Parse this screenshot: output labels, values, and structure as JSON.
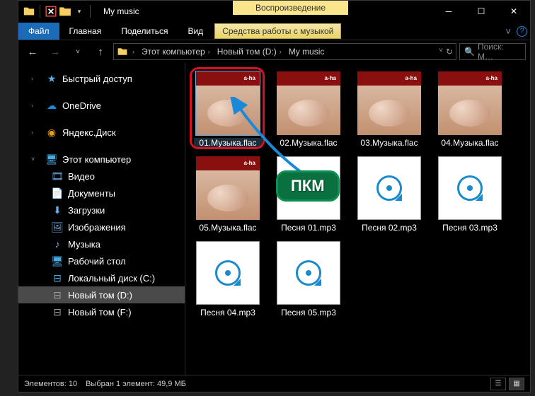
{
  "title": "My music",
  "context_tab": "Воспроизведение",
  "ribbon": {
    "file": "Файл",
    "home": "Главная",
    "share": "Поделиться",
    "view": "Вид",
    "music_tools": "Средства работы с музыкой"
  },
  "breadcrumb": {
    "this_pc": "Этот компьютер",
    "drive": "Новый том (D:)",
    "folder": "My music"
  },
  "search_placeholder": "Поиск: M…",
  "sidebar": {
    "quick_access": "Быстрый доступ",
    "onedrive": "OneDrive",
    "yandex": "Яндекс.Диск",
    "this_pc": "Этот компьютер",
    "videos": "Видео",
    "documents": "Документы",
    "downloads": "Загрузки",
    "pictures": "Изображения",
    "music": "Музыка",
    "desktop": "Рабочий стол",
    "drive_c": "Локальный диск (C:)",
    "drive_d": "Новый том (D:)",
    "drive_f": "Новый том (F:)"
  },
  "files": {
    "f1": "01.Музыка.flac",
    "f2": "02.Музыка.flac",
    "f3": "03.Музыка.flac",
    "f4": "04.Музыка.flac",
    "f5": "05.Музыка.flac",
    "f6": "Песня 01.mp3",
    "f7": "Песня 02.mp3",
    "f8": "Песня 03.mp3",
    "f9": "Песня 04.mp3",
    "f10": "Песня 05.mp3"
  },
  "status": {
    "count_label": "Элементов:",
    "count": "10",
    "selection": "Выбран 1 элемент: 49,9 МБ"
  },
  "annotation": "ПКМ",
  "album_tag": "a-ha"
}
